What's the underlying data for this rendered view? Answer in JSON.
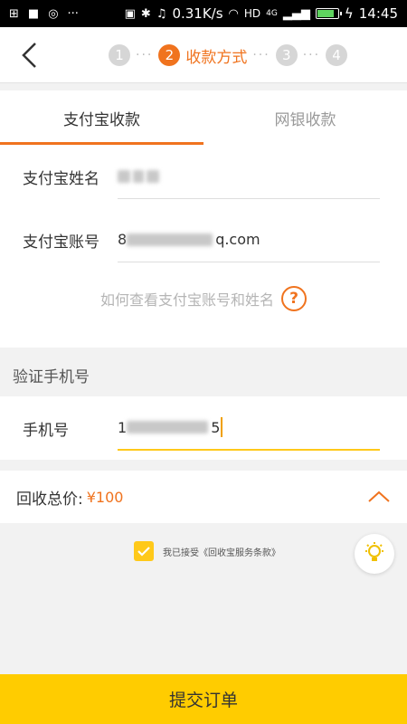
{
  "status_bar": {
    "speed": "0.31K/s",
    "network": "HD",
    "signal": "4G",
    "time": "14:45",
    "battery_level": 0.85
  },
  "header": {
    "steps": [
      {
        "num": "1"
      },
      {
        "num": "2",
        "label": "收款方式"
      },
      {
        "num": "3"
      },
      {
        "num": "4"
      }
    ]
  },
  "tabs": [
    {
      "label": "支付宝收款",
      "active": true
    },
    {
      "label": "网银收款",
      "active": false
    }
  ],
  "alipay_form": {
    "name_label": "支付宝姓名",
    "account_label": "支付宝账号",
    "account_prefix": "8",
    "account_suffix": "q.com",
    "help_text": "如何查看支付宝账号和姓名",
    "help_icon": "?"
  },
  "verify": {
    "section_title": "验证手机号",
    "phone_label": "手机号",
    "phone_prefix": "1",
    "phone_suffix": "5"
  },
  "total": {
    "label": "回收总价:",
    "price": "¥100"
  },
  "agreement": {
    "text": "我已接受《回收宝服务条款》",
    "checked": true
  },
  "submit": {
    "label": "提交订单"
  },
  "colors": {
    "accent": "#f0731e",
    "yellow": "#ffcc00"
  }
}
